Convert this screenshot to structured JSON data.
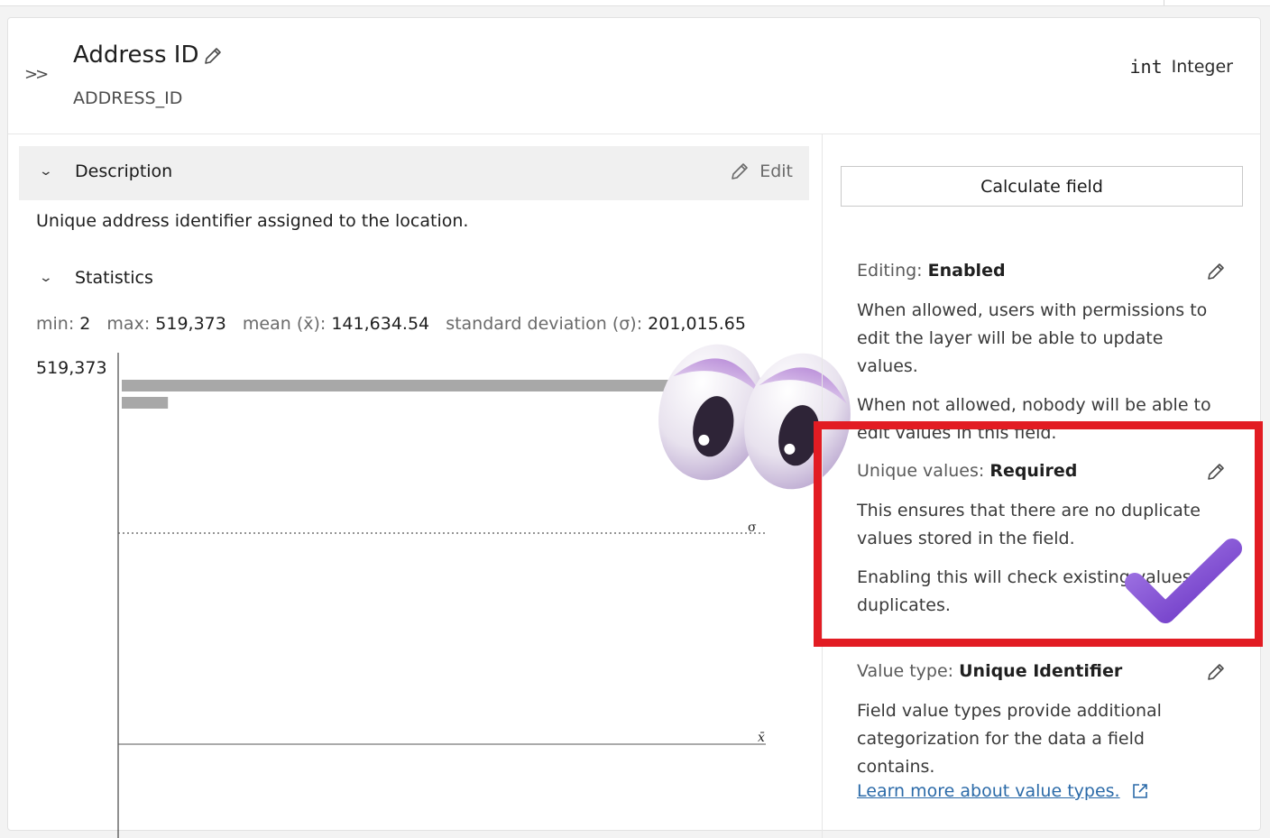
{
  "header": {
    "expand_icon": "double-chevron-right-icon",
    "title": "Address ID",
    "edit_icon": "pencil-icon",
    "field_name": "ADDRESS_ID",
    "type_icon_text": "int",
    "type_label": "Integer"
  },
  "description": {
    "section_title": "Description",
    "edit_label": "Edit",
    "text": "Unique address identifier assigned to the location."
  },
  "statistics": {
    "section_title": "Statistics",
    "min_label": "min:",
    "min_value": "2",
    "max_label": "max:",
    "max_value": "519,373",
    "mean_label": "mean (x̄):",
    "mean_value": "141,634.54",
    "std_label": "standard deviation (σ):",
    "std_value": "201,015.65",
    "sigma_marker": "σ",
    "mean_marker": "x̄"
  },
  "chart_data": {
    "type": "bar",
    "orientation": "horizontal-histogram",
    "y_axis_top_label": "519,373",
    "values": [
      1.0,
      0.08
    ],
    "reference_lines": [
      {
        "label": "σ",
        "style": "dotted"
      },
      {
        "label": "x̄",
        "style": "solid"
      }
    ]
  },
  "right_panel": {
    "calculate_label": "Calculate field",
    "editing": {
      "label": "Editing:",
      "value": "Enabled",
      "text1": "When allowed, users with permissions to edit the layer will be able to update values.",
      "text2": "When not allowed, nobody will be able to edit values in this field."
    },
    "unique": {
      "label": "Unique values:",
      "value": "Required",
      "text1": "This ensures that there are no duplicate values stored in the field.",
      "text2": "Enabling this will check existing values duplicates."
    },
    "value_type": {
      "label": "Value type:",
      "value": "Unique Identifier",
      "text": "Field value types provide additional categorization for the data a field contains.",
      "link": "Learn more about value types.",
      "link_icon": "external-link-icon"
    }
  },
  "colors": {
    "highlight": "#e21c23",
    "link": "#2b6aa8",
    "bar": "#a8a8a8",
    "decoration": "#8e5bd6"
  }
}
